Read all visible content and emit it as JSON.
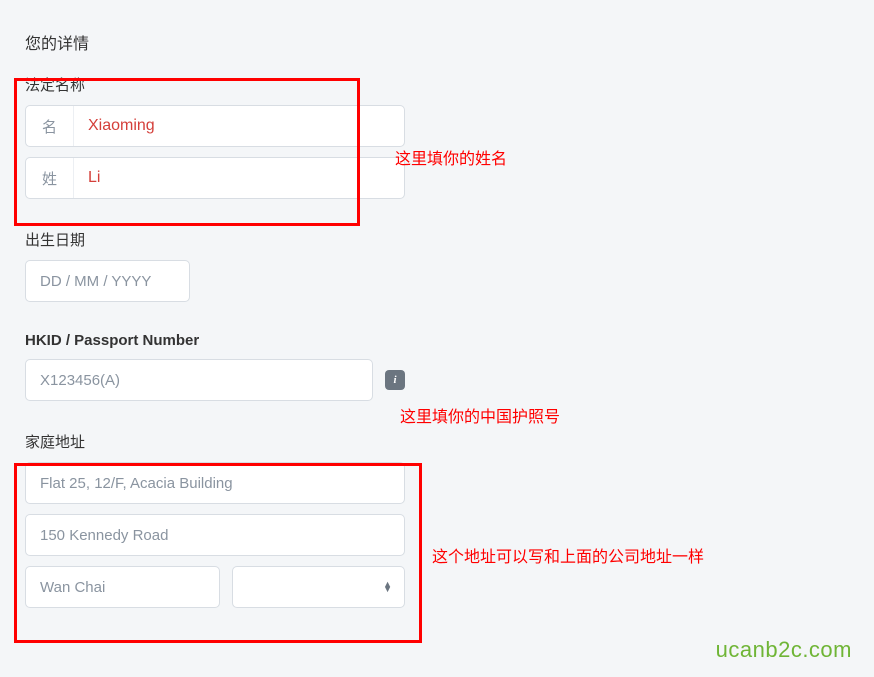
{
  "heading": "您的详情",
  "legal_name": {
    "label": "法定名称",
    "given_prefix": "名",
    "given_value": "Xiaoming",
    "family_prefix": "姓",
    "family_value": "Li"
  },
  "dob": {
    "label": "出生日期",
    "placeholder": "DD / MM / YYYY"
  },
  "hkid": {
    "label": "HKID / Passport Number",
    "placeholder": "X123456(A)",
    "info_icon": "i"
  },
  "address": {
    "label": "家庭地址",
    "line1_placeholder": "Flat 25, 12/F, Acacia Building",
    "line2_placeholder": "150 Kennedy Road",
    "district_placeholder": "Wan Chai"
  },
  "annotations": {
    "name": "这里填你的姓名",
    "hkid": "这里填你的中国护照号",
    "addr": "这个地址可以写和上面的公司地址一样"
  },
  "watermark": "ucanb2c.com"
}
